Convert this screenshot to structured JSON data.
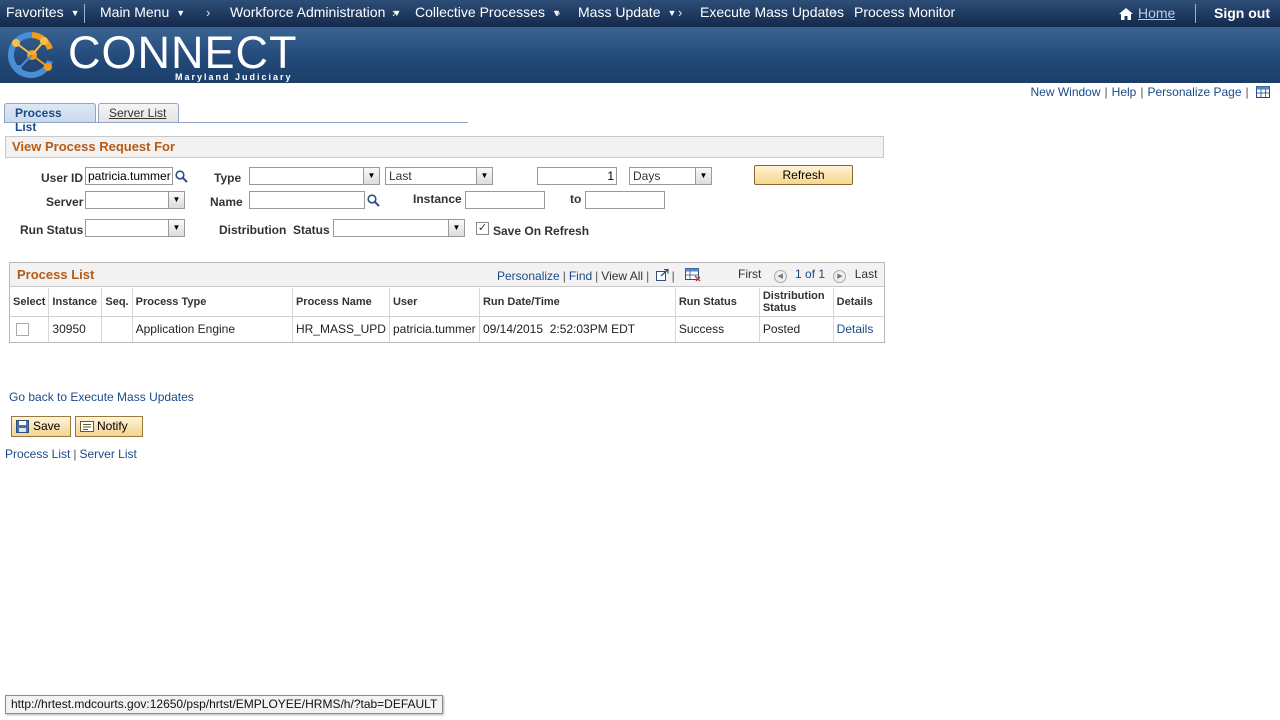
{
  "nav": {
    "favorites": "Favorites",
    "main_menu": "Main Menu",
    "breadcrumbs": [
      "Workforce Administration",
      "Collective Processes",
      "Mass Update",
      "Execute Mass Updates",
      "Process Monitor"
    ],
    "home": "Home",
    "sign_out": "Sign out"
  },
  "banner": {
    "logo_text": "CONNECT",
    "logo_subtitle": "Maryland Judiciary"
  },
  "page_links": [
    "New Window",
    "Help",
    "Personalize Page"
  ],
  "tabs": [
    {
      "label": "Process List",
      "active": true
    },
    {
      "label": "Server List",
      "active": false
    }
  ],
  "filters": {
    "header": "View Process Request For",
    "user_id_label": "User ID",
    "user_id_value": "patricia.tummer",
    "type_label": "Type",
    "type_value": "",
    "last_value": "Last",
    "period_value": "1",
    "days_value": "Days",
    "refresh": "Refresh",
    "server_label": "Server",
    "server_value": "",
    "name_label": "Name",
    "name_value": "",
    "instance_label": "Instance",
    "instance_from": "",
    "to_label": "to",
    "instance_to": "",
    "run_status_label": "Run Status",
    "run_status_value": "",
    "dist_status_label": "Distribution  Status",
    "dist_status_value": "",
    "save_on_refresh_label": "Save On Refresh",
    "save_on_refresh_checked": true
  },
  "grid": {
    "title": "Process List",
    "personalize": "Personalize",
    "find": "Find",
    "view_all": "View All",
    "first": "First",
    "page": "1 of 1",
    "last": "Last",
    "columns": [
      "Select",
      "Instance",
      "Seq.",
      "Process Type",
      "Process Name",
      "User",
      "Run Date/Time",
      "Run Status",
      "Distribution Status",
      "Details"
    ],
    "rows": [
      {
        "instance": "30950",
        "seq": "",
        "process_type": "Application Engine",
        "process_name": "HR_MASS_UPD",
        "user": "patricia.tummer",
        "run_datetime": "09/14/2015  2:52:03PM EDT",
        "run_status": "Success",
        "dist_status": "Posted",
        "details": "Details"
      }
    ]
  },
  "footer": {
    "go_back": "Go back to Execute Mass Updates",
    "save": "Save",
    "notify": "Notify",
    "links": [
      "Process List",
      "Server List"
    ]
  },
  "statusbar": "http://hrtest.mdcourts.gov:12650/psp/hrtst/EMPLOYEE/HRMS/h/?tab=DEFAULT",
  "colors": {
    "nav_bg": "#13294b",
    "banner_bg": "#234a7a",
    "link": "#1a4a8a",
    "section_title": "#b85b14",
    "button_bg": "#f7d58e"
  }
}
